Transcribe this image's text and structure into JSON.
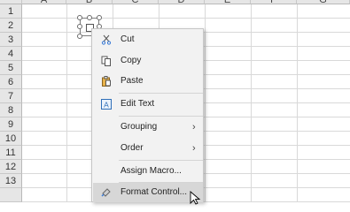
{
  "columns": [
    "A",
    "B",
    "C",
    "D",
    "E",
    "F",
    "G"
  ],
  "rows": [
    "1",
    "2",
    "3",
    "4",
    "5",
    "6",
    "7",
    "8",
    "9",
    "10",
    "11",
    "12",
    "13"
  ],
  "menu": {
    "items": [
      {
        "label": "Cut",
        "icon": "scissors-icon"
      },
      {
        "label": "Copy",
        "icon": "copy-icon"
      },
      {
        "label": "Paste",
        "icon": "paste-icon"
      },
      {
        "label": "Edit Text",
        "icon": "edit-text-icon"
      },
      {
        "label": "Grouping",
        "submenu": true
      },
      {
        "label": "Order",
        "submenu": true
      },
      {
        "label": "Assign Macro..."
      },
      {
        "label": "Format Control...",
        "icon": "format-control-icon",
        "highlighted": true
      }
    ]
  },
  "colors": {
    "menu_bg": "#f2f2f2",
    "highlight": "#d7d7d7",
    "header_bg": "#e6e6e6",
    "grid": "#d9d9d9"
  }
}
